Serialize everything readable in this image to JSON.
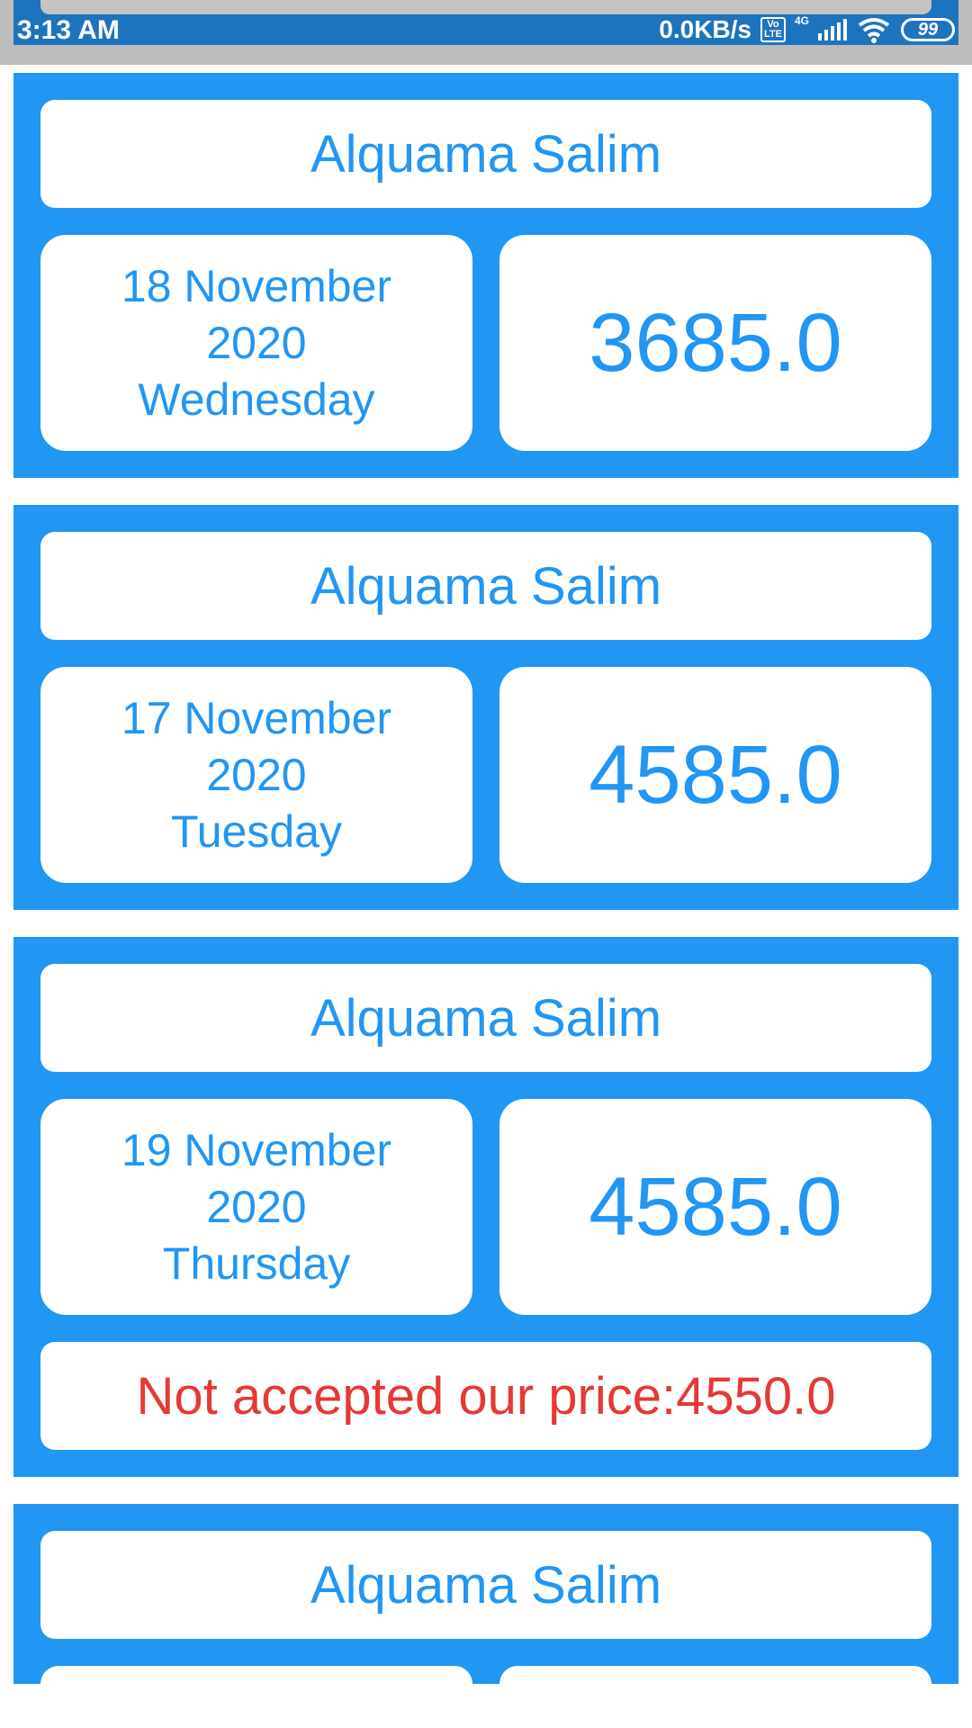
{
  "status_bar": {
    "time": "3:13 AM",
    "net_speed": "0.0KB/s",
    "volte_label": "Vo LTE",
    "network_label": "4G",
    "battery": "99"
  },
  "cards": [
    {
      "name": "Alquama Salim",
      "date_line1": "18 November",
      "date_line2": "2020",
      "date_line3": "Wednesday",
      "amount": "3685.0"
    },
    {
      "name": "Alquama Salim",
      "date_line1": "17 November",
      "date_line2": "2020",
      "date_line3": "Tuesday",
      "amount": "4585.0"
    },
    {
      "name": "Alquama Salim",
      "date_line1": "19 November",
      "date_line2": "2020",
      "date_line3": "Thursday",
      "amount": "4585.0",
      "note": "Not accepted our price:4550.0"
    },
    {
      "name": "Alquama Salim"
    }
  ],
  "colors": {
    "card_bg": "#2196f3",
    "text_blue": "#2196f3",
    "text_red": "#e53935",
    "status_bar": "#1e73be"
  }
}
